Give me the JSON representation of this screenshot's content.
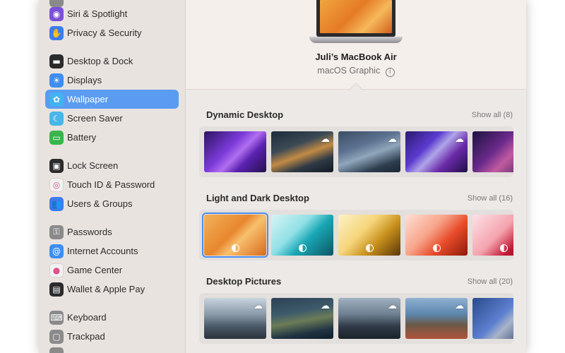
{
  "sidebar": {
    "items": [
      {
        "label": "Siri & Spotlight",
        "icon": "siri-icon",
        "glyph": "◉",
        "color": "#7b4fd6"
      },
      {
        "label": "Privacy & Security",
        "icon": "hand-icon",
        "glyph": "✋",
        "color": "#3d7bf0"
      },
      {
        "label": "Desktop & Dock",
        "icon": "dock-icon",
        "glyph": "▬",
        "color": "#2b2b2b"
      },
      {
        "label": "Displays",
        "icon": "sun-icon",
        "glyph": "☀",
        "color": "#3d8ef0"
      },
      {
        "label": "Wallpaper",
        "icon": "flower-icon",
        "glyph": "✿",
        "color": "#43b2f0",
        "selected": true
      },
      {
        "label": "Screen Saver",
        "icon": "moon-icon",
        "glyph": "☾",
        "color": "#48b6e8"
      },
      {
        "label": "Battery",
        "icon": "battery-icon",
        "glyph": "▭",
        "color": "#39b54a"
      },
      {
        "label": "Lock Screen",
        "icon": "lock-screen-icon",
        "glyph": "▣",
        "color": "#2b2b2b"
      },
      {
        "label": "Touch ID & Password",
        "icon": "fingerprint-icon",
        "glyph": "◎",
        "color": "#f2f2f2"
      },
      {
        "label": "Users & Groups",
        "icon": "users-icon",
        "glyph": "👥",
        "color": "#3d7bf0"
      },
      {
        "label": "Passwords",
        "icon": "key-icon",
        "glyph": "⚿",
        "color": "#8a8a8a"
      },
      {
        "label": "Internet Accounts",
        "icon": "at-icon",
        "glyph": "@",
        "color": "#3d8ef0"
      },
      {
        "label": "Game Center",
        "icon": "game-center-icon",
        "glyph": "●",
        "color": "#f2f2f2"
      },
      {
        "label": "Wallet & Apple Pay",
        "icon": "wallet-icon",
        "glyph": "▤",
        "color": "#2b2b2b"
      },
      {
        "label": "Keyboard",
        "icon": "keyboard-icon",
        "glyph": "⌨",
        "color": "#8a8a8a"
      },
      {
        "label": "Trackpad",
        "icon": "trackpad-icon",
        "glyph": "▢",
        "color": "#8a8a8a"
      }
    ]
  },
  "header": {
    "device_name": "Juli’s MacBook Air",
    "device_subtitle": "macOS Graphic",
    "info_glyph": "i"
  },
  "sections": [
    {
      "title": "Dynamic Desktop",
      "show_all": "Show all (8)",
      "thumbs": [
        {
          "name": "ventura-purple",
          "bg": "linear-gradient(135deg,#2d1460 0%,#7b3ad9 40%,#b16ef0 55%,#5a22b0 70%,#24104f 100%)",
          "cloud": false
        },
        {
          "name": "big-sur-coast-night",
          "bg": "linear-gradient(160deg,#1d2a3a 0%,#3b4a55 35%,#c28a45 55%,#2e3a46 75%,#111a24 100%)",
          "cloud": true
        },
        {
          "name": "catalina-island",
          "bg": "linear-gradient(160deg,#3a4d64 0%,#5d7290 35%,#8fa6bb 55%,#2e3d4f 80%,#1a2634 100%)",
          "cloud": true
        },
        {
          "name": "mojave-violet-rocks",
          "bg": "linear-gradient(135deg,#2a1a6e 0%,#5b3bd0 35%,#b0a4e8 50%,#6a2aa8 70%,#1e0f45 100%)",
          "cloud": true
        },
        {
          "name": "sunset-hills",
          "bg": "linear-gradient(135deg,#1c1240 0%,#6a2a8a 40%,#c25aa0 60%,#2b1a55 100%)",
          "cloud": false
        }
      ]
    },
    {
      "title": "Light and Dark Desktop",
      "show_all": "Show all (16)",
      "thumbs": [
        {
          "name": "ventura-orange",
          "bg": "linear-gradient(135deg,#f2b35a 0%,#e8862e 45%,#f7c06e 60%,#d86a1c 100%)",
          "mode": true,
          "selected": true
        },
        {
          "name": "aqua-waves",
          "bg": "linear-gradient(135deg,#d8f4f6 0%,#8fe0e6 40%,#1aa7b5 60%,#0d5563 100%)",
          "mode": true
        },
        {
          "name": "golden-waves",
          "bg": "linear-gradient(135deg,#fdf1c8 0%,#f5d57a 40%,#c8901c 65%,#5a3608 100%)",
          "mode": true
        },
        {
          "name": "coral-waves",
          "bg": "linear-gradient(135deg,#fde0d4 0%,#f7a48a 40%,#e84b2a 65%,#8c1a0a 100%)",
          "mode": true
        },
        {
          "name": "rose-waves",
          "bg": "linear-gradient(135deg,#fde2e6 0%,#f4a3ae 45%,#c21a35 70%,#5c0a18 100%)",
          "mode": true
        }
      ]
    },
    {
      "title": "Desktop Pictures",
      "show_all": "Show all (20)",
      "thumbs": [
        {
          "name": "misty-mountains",
          "bg": "linear-gradient(180deg,#c8d4de 0%,#8a9aa8 40%,#4a5866 70%,#2a333d 100%)",
          "cloud": true
        },
        {
          "name": "island-coast",
          "bg": "linear-gradient(170deg,#2c4254 0%,#3d5a6b 35%,#6c7c58 55%,#1f3342 80%,#0f1f2b 100%)",
          "cloud": true
        },
        {
          "name": "rocky-shore",
          "bg": "linear-gradient(180deg,#9fb0c0 0%,#6d7f90 40%,#2f3a46 70%,#1a222b 100%)",
          "cloud": true
        },
        {
          "name": "sea-cliffs",
          "bg": "linear-gradient(180deg,#8fb0d0 0%,#5c86ad 40%,#6a5a48 65%,#b0523a 100%)",
          "cloud": true
        },
        {
          "name": "blue-rock",
          "bg": "linear-gradient(135deg,#2a4a8a 0%,#5c7fd0 45%,#a8b4c8 60%,#1c2f66 100%)",
          "cloud": false
        }
      ]
    }
  ],
  "partial_top_icon": {
    "icon": "partial-icon",
    "color": "#8a8a8a"
  },
  "partial_bottom_icon": {
    "icon": "game-controllers-icon",
    "color": "#8a8a8a"
  }
}
